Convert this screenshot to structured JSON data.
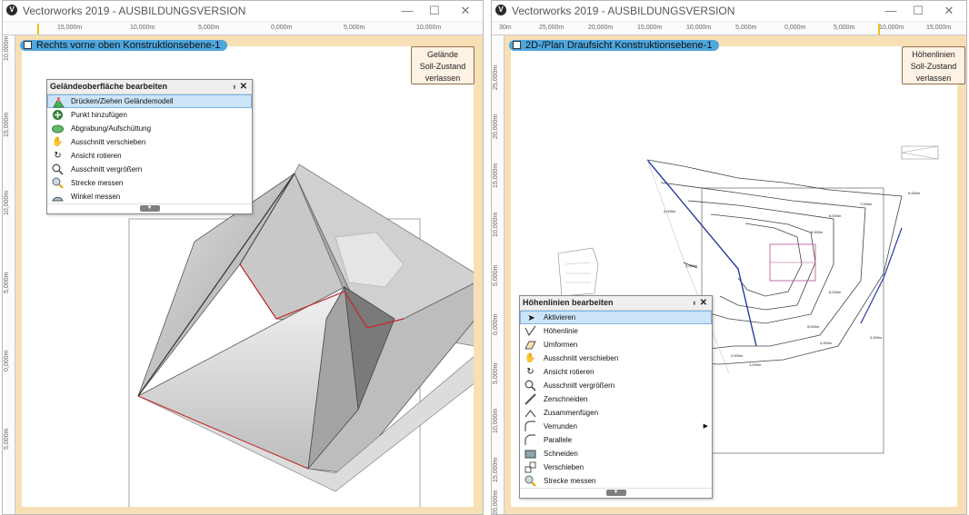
{
  "left_window": {
    "title": "Vectorworks 2019 - AUSBILDUNGSVERSION",
    "ruler_h": [
      "15,000m",
      "10,000m",
      "5,000m",
      "0,000m",
      "5,000m",
      "10,000m"
    ],
    "ruler_v": [
      "10,000m",
      "15,000m",
      "10,000m",
      "5,000m",
      "0,000m",
      "5,000m"
    ],
    "view_label": "Rechts vorne oben  Konstruktionsebene-1",
    "exit_button": "Gelände\nSoll-Zustand\nverlassen",
    "palette": {
      "title": "Geländeoberfläche bearbeiten",
      "items": [
        {
          "label": "Drücken/Ziehen Geländemodell",
          "icon": "push-pull-terrain-icon",
          "selected": true
        },
        {
          "label": "Punkt hinzufügen",
          "icon": "add-point-icon"
        },
        {
          "label": "Abgrabung/Aufschüttung",
          "icon": "cut-fill-icon"
        },
        {
          "label": "Ausschnitt verschieben",
          "icon": "pan-hand-icon"
        },
        {
          "label": "Ansicht rotieren",
          "icon": "rotate-view-icon"
        },
        {
          "label": "Ausschnitt vergrößern",
          "icon": "zoom-icon"
        },
        {
          "label": "Strecke messen",
          "icon": "measure-distance-icon"
        },
        {
          "label": "Winkel messen",
          "icon": "measure-angle-icon"
        }
      ]
    }
  },
  "right_window": {
    "title": "Vectorworks 2019 - AUSBILDUNGSVERSION",
    "ruler_h": [
      "30m",
      "25,000m",
      "20,000m",
      "15,000m",
      "10,000m",
      "5,000m",
      "0,000m",
      "5,000m",
      "10,000m",
      "15,000m"
    ],
    "ruler_v": [
      "25,000m",
      "20,000m",
      "15,000m",
      "10,000m",
      "5,000m",
      "0,000m",
      "5,000m",
      "10,000m",
      "15,000m",
      "20,000m"
    ],
    "view_label": "2D-/Plan Draufsicht  Konstruktionsebene-1",
    "exit_button": "Höhenlinien\nSoll-Zustand\nverlassen",
    "contour_labels": [
      "6,000m",
      "7,000m",
      "8,000m",
      "4,000m",
      "3,000m",
      "9,000m",
      "2,000m",
      "1,000m",
      "6,000m",
      "5,000m",
      "4,000m",
      "3,000m"
    ],
    "palette": {
      "title": "Höhenlinien bearbeiten",
      "items": [
        {
          "label": "Aktivieren",
          "icon": "arrow-cursor-icon",
          "selected": true
        },
        {
          "label": "Höhenlinie",
          "icon": "contour-line-icon"
        },
        {
          "label": "Umformen",
          "icon": "reshape-icon"
        },
        {
          "label": "Ausschnitt verschieben",
          "icon": "pan-hand-icon"
        },
        {
          "label": "Ansicht rotieren",
          "icon": "rotate-view-icon"
        },
        {
          "label": "Ausschnitt vergrößern",
          "icon": "zoom-icon"
        },
        {
          "label": "Zerschneiden",
          "icon": "knife-icon"
        },
        {
          "label": "Zusammenfügen",
          "icon": "join-icon"
        },
        {
          "label": "Verrunden",
          "icon": "fillet-icon",
          "has_submenu": true
        },
        {
          "label": "Parallele",
          "icon": "offset-icon"
        },
        {
          "label": "Schneiden",
          "icon": "clip-icon"
        },
        {
          "label": "Verschieben",
          "icon": "move-icon"
        },
        {
          "label": "Strecke messen",
          "icon": "measure-distance-icon"
        }
      ]
    }
  },
  "window_controls": {
    "minimize": "—",
    "maximize": "☐",
    "close": "✕"
  },
  "colors": {
    "viewport_border": "#f7e0b6",
    "view_label_bg": "#4ea6dd",
    "selection": "#cce4f7",
    "contour_blue": "#2b3c9c",
    "terrain_edge": "#c62828"
  }
}
